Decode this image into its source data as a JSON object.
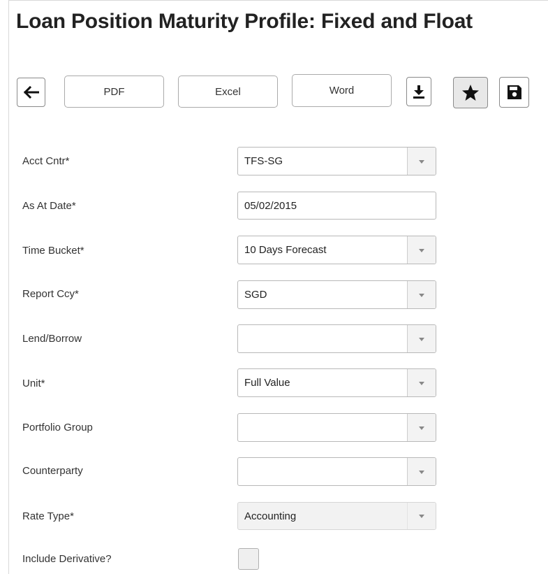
{
  "header": {
    "title": "Loan Position Maturity Profile: Fixed and Float"
  },
  "toolbar": {
    "back_icon": "arrow-left-icon",
    "pdf_label": "PDF",
    "excel_label": "Excel",
    "word_label": "Word",
    "download_icon": "download-icon",
    "favorite_icon": "star-icon",
    "save_icon": "floppy-disk-icon"
  },
  "form": {
    "acct_cntr": {
      "label": "Acct Cntr*",
      "value": "TFS-SG"
    },
    "as_at_date": {
      "label": "As At Date*",
      "value": "05/02/2015"
    },
    "time_bucket": {
      "label": "Time Bucket*",
      "value": "10 Days Forecast"
    },
    "report_ccy": {
      "label": "Report Ccy*",
      "value": "SGD"
    },
    "lend_borrow": {
      "label": "Lend/Borrow",
      "value": ""
    },
    "unit": {
      "label": "Unit*",
      "value": "Full Value"
    },
    "portfolio_group": {
      "label": "Portfolio Group",
      "value": ""
    },
    "counterparty": {
      "label": "Counterparty",
      "value": ""
    },
    "rate_type": {
      "label": "Rate Type*",
      "value": "Accounting"
    },
    "include_derivative": {
      "label": "Include Derivative?",
      "checked": false
    }
  },
  "colors": {
    "border": "#b8b8b8",
    "dropdown_bg": "#f3f3f3",
    "text": "#222222"
  }
}
